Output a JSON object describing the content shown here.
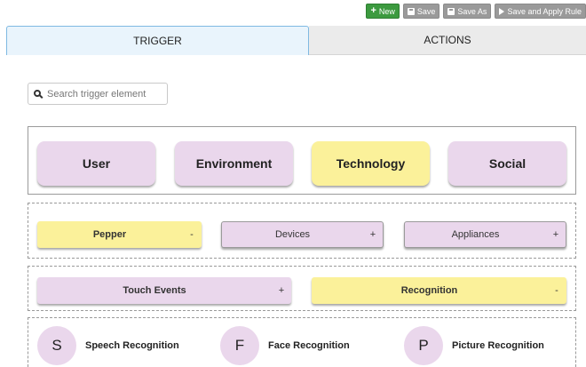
{
  "toolbar": {
    "new_label": "New",
    "save_label": "Save",
    "save_as_label": "Save As",
    "save_apply_label": "Save and Apply Rule"
  },
  "tabs": [
    {
      "label": "TRIGGER",
      "active": true
    },
    {
      "label": "ACTIONS",
      "active": false
    }
  ],
  "search": {
    "placeholder": "Search trigger element",
    "value": ""
  },
  "categories": [
    {
      "label": "User",
      "selected": false
    },
    {
      "label": "Environment",
      "selected": false
    },
    {
      "label": "Technology",
      "selected": true
    },
    {
      "label": "Social",
      "selected": false
    }
  ],
  "technology_items": [
    {
      "label": "Pepper",
      "sign": "-",
      "selected": true
    },
    {
      "label": "Devices",
      "sign": "+",
      "selected": false
    },
    {
      "label": "Appliances",
      "sign": "+",
      "selected": false
    }
  ],
  "pepper_items": [
    {
      "label": "Touch Events",
      "sign": "+",
      "selected": false
    },
    {
      "label": "Recognition",
      "sign": "-",
      "selected": true
    }
  ],
  "recognition_items": [
    {
      "letter": "S",
      "label": "Speech Recognition"
    },
    {
      "letter": "F",
      "label": "Face Recognition"
    },
    {
      "letter": "P",
      "label": "Picture Recognition"
    }
  ],
  "colors": {
    "accent_green": "#3c9a3f",
    "purple": "#ead7ec",
    "yellow": "#fbf19a",
    "tab_active": "#e9f4fc"
  }
}
